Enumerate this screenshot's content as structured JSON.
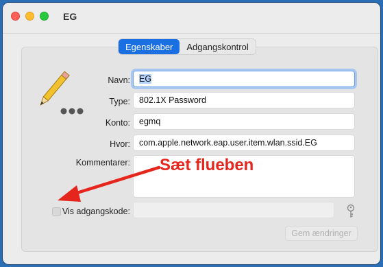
{
  "window": {
    "title": "EG"
  },
  "tabs": [
    {
      "label": "Egenskaber",
      "active": true
    },
    {
      "label": "Adgangskontrol",
      "active": false
    }
  ],
  "form": {
    "name": {
      "label": "Navn:",
      "value": "EG"
    },
    "type": {
      "label": "Type:",
      "value": "802.1X Password"
    },
    "account": {
      "label": "Konto:",
      "value": "egmq"
    },
    "where": {
      "label": "Hvor:",
      "value": "com.apple.network.eap.user.item.wlan.ssid.EG"
    },
    "comments": {
      "label": "Kommentarer:",
      "value": ""
    },
    "show_password": {
      "label": "Vis adgangskode:",
      "checked": false,
      "value": ""
    }
  },
  "save_button": {
    "label": "Gem ændringer",
    "enabled": false
  },
  "annotation": {
    "text": "Sæt flueben",
    "color": "#e5261d"
  },
  "colors": {
    "accent": "#1a6fe3",
    "background": "#2a6fb6"
  },
  "icons": [
    "pencil-icon",
    "key-icon",
    "close-icon",
    "minimize-icon",
    "zoom-icon"
  ]
}
